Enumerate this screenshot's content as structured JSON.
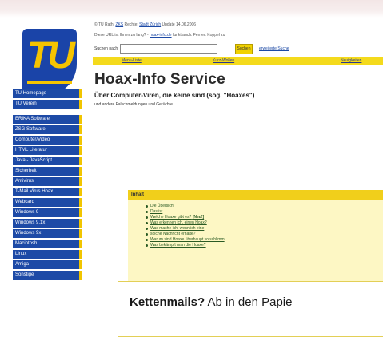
{
  "sidebar": {
    "logo_text": "TU",
    "items": [
      "TU Homepage",
      "TU Verein",
      "ERIKA Software",
      "ZSG Software",
      "Computer/Video",
      "HTML Literatur",
      "Java - JavaScript",
      "Sicherheit",
      "Antivirus",
      "T-Mail Virus Hoax",
      "Webcard",
      "Windows 9",
      "Windows 9.1x",
      "Windows 9x",
      "Macintosh",
      "Linux",
      "Amiga",
      "Sonstige"
    ]
  },
  "header": {
    "line1_prefix": "© TU Rath,",
    "line1_link1": "ZKS",
    "line1_mid": "Rechte:",
    "line1_link2": "Stadt Zürich",
    "line1_suffix": "Update 14.06.2006",
    "line2_prefix": "Diese URL ist Ihnen zu lang? -",
    "line2_link": "hoax-info.de",
    "line2_suffix": "funkt auch. Ferner: Koppel zu"
  },
  "search": {
    "label": "Suchen nach",
    "value": "",
    "button": "Suchen",
    "advanced": "erweiterte Suche"
  },
  "nav_bar": [
    "Menu-Liste",
    "Kurz-Wollen",
    "Neuigkeiten"
  ],
  "main": {
    "title": "Hoax-Info Service",
    "subtitle": "Über Computer-Viren, die keine sind (sog. \"Hoaxes\")",
    "subtitle2": "und andere Falschmeldungen und Gerüchte"
  },
  "toc": {
    "header": "Inhalt",
    "items": [
      "Die Übersicht",
      "Das ist",
      "Welche Hoaxe gibt es?",
      "Was erkennen ich, einen Hoax?",
      "Was mache ich, wenn ich eine",
      "solche Nachricht erhalte?",
      "Warum sind Hoaxe überhaupt so schlimm",
      "Was bekämpft man die Hoaxe?"
    ],
    "new_badge": "[Neu!]"
  },
  "caption": {
    "bold": "Kettenmails?",
    "rest": "Ab in den Papie"
  }
}
